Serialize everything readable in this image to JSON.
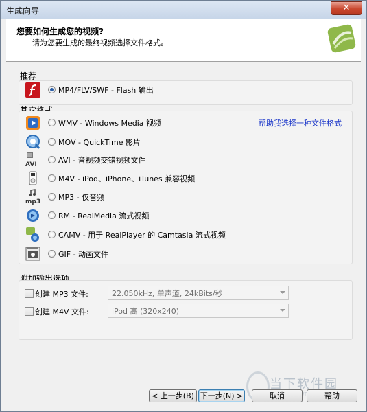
{
  "window": {
    "title": "生成向导",
    "close_label": "✕"
  },
  "header": {
    "title": "您要如何生成您的视频?",
    "subtitle": "请为您要生成的最终视频选择文件格式。"
  },
  "recommended": {
    "label": "推荐",
    "option": {
      "label": "MP4/FLV/SWF - Flash 输出",
      "selected": true,
      "icon": "flash-icon"
    }
  },
  "other_formats": {
    "label": "其它格式",
    "help_link": "帮助我选择一种文件格式",
    "options": [
      {
        "label": "WMV - Windows Media 视频",
        "icon": "windows-media-icon"
      },
      {
        "label": "MOV - QuickTime 影片",
        "icon": "quicktime-icon"
      },
      {
        "label": "AVI - 音视频交错视频文件",
        "icon": "avi-icon",
        "icon_text": "AVI"
      },
      {
        "label": "M4V - iPod、iPhone、iTunes 兼容视频",
        "icon": "ipod-icon"
      },
      {
        "label": "MP3 - 仅音频",
        "icon": "mp3-icon",
        "icon_text": "mp3"
      },
      {
        "label": "RM - RealMedia 流式视频",
        "icon": "realmedia-icon"
      },
      {
        "label": "CAMV - 用于 RealPlayer 的 Camtasia 流式视频",
        "icon": "camv-icon"
      },
      {
        "label": "GIF - 动画文件",
        "icon": "gif-icon"
      }
    ]
  },
  "additional": {
    "label": "附加输出选项",
    "mp3": {
      "label": "创建 MP3 文件:",
      "value": "22.050kHz, 单声道, 24kBits/秒"
    },
    "m4v": {
      "label": "创建 M4V 文件:",
      "value": "iPod 高 (320x240)"
    }
  },
  "buttons": {
    "back": "< 上一步(B)",
    "next": "下一步(N) >",
    "cancel": "取消",
    "help": "帮助"
  },
  "watermark": {
    "text": "当下软件园",
    "url": "www.downxia.com"
  },
  "colors": {
    "link": "#1a36c9",
    "accent": "#2b5fa8"
  }
}
